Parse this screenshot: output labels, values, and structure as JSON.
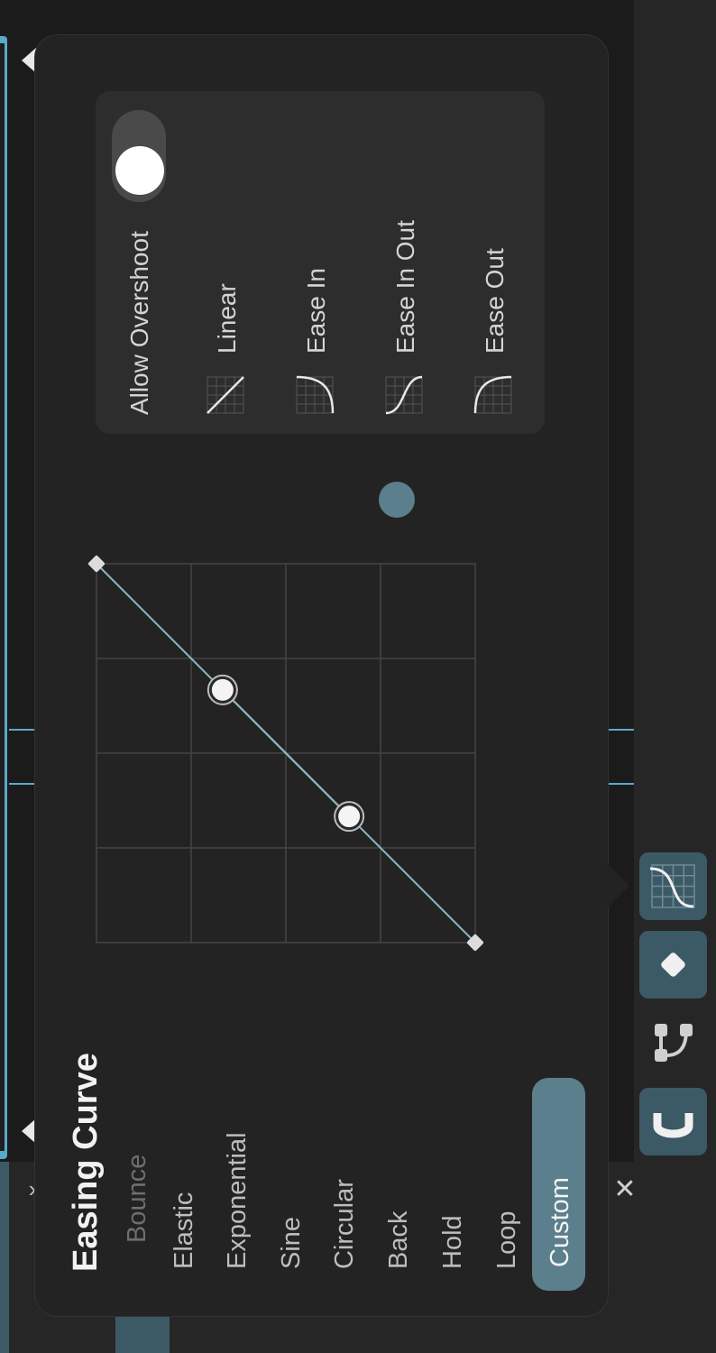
{
  "panel": {
    "title": "Easing Curve",
    "categories": [
      {
        "label": "Bounce",
        "faded": true
      },
      {
        "label": "Elastic"
      },
      {
        "label": "Exponential"
      },
      {
        "label": "Sine"
      },
      {
        "label": "Circular"
      },
      {
        "label": "Back"
      },
      {
        "label": "Hold"
      },
      {
        "label": "Loop"
      }
    ],
    "custom_label": "Custom"
  },
  "options": {
    "allow_overshoot_label": "Allow Overshoot",
    "allow_overshoot_on": true,
    "presets": [
      {
        "label": "Linear",
        "icon": "linear-curve-icon"
      },
      {
        "label": "Ease In",
        "icon": "ease-in-curve-icon"
      },
      {
        "label": "Ease In Out",
        "icon": "ease-in-out-curve-icon"
      },
      {
        "label": "Ease Out",
        "icon": "ease-out-curve-icon"
      }
    ]
  },
  "curve": {
    "start": [
      0,
      0
    ],
    "end": [
      1,
      1
    ],
    "handle1": [
      0.333,
      0.333
    ],
    "handle2": [
      0.667,
      0.667
    ]
  },
  "toolbar": {
    "tools": [
      "easing-curve-tool",
      "keyframe-tool",
      "path-tool",
      "magnet-snap-tool"
    ],
    "active": "easing-curve-tool"
  },
  "colors": {
    "accent": "#5b7f8c",
    "curve": "#8fb7c9",
    "panel": "#232323"
  }
}
